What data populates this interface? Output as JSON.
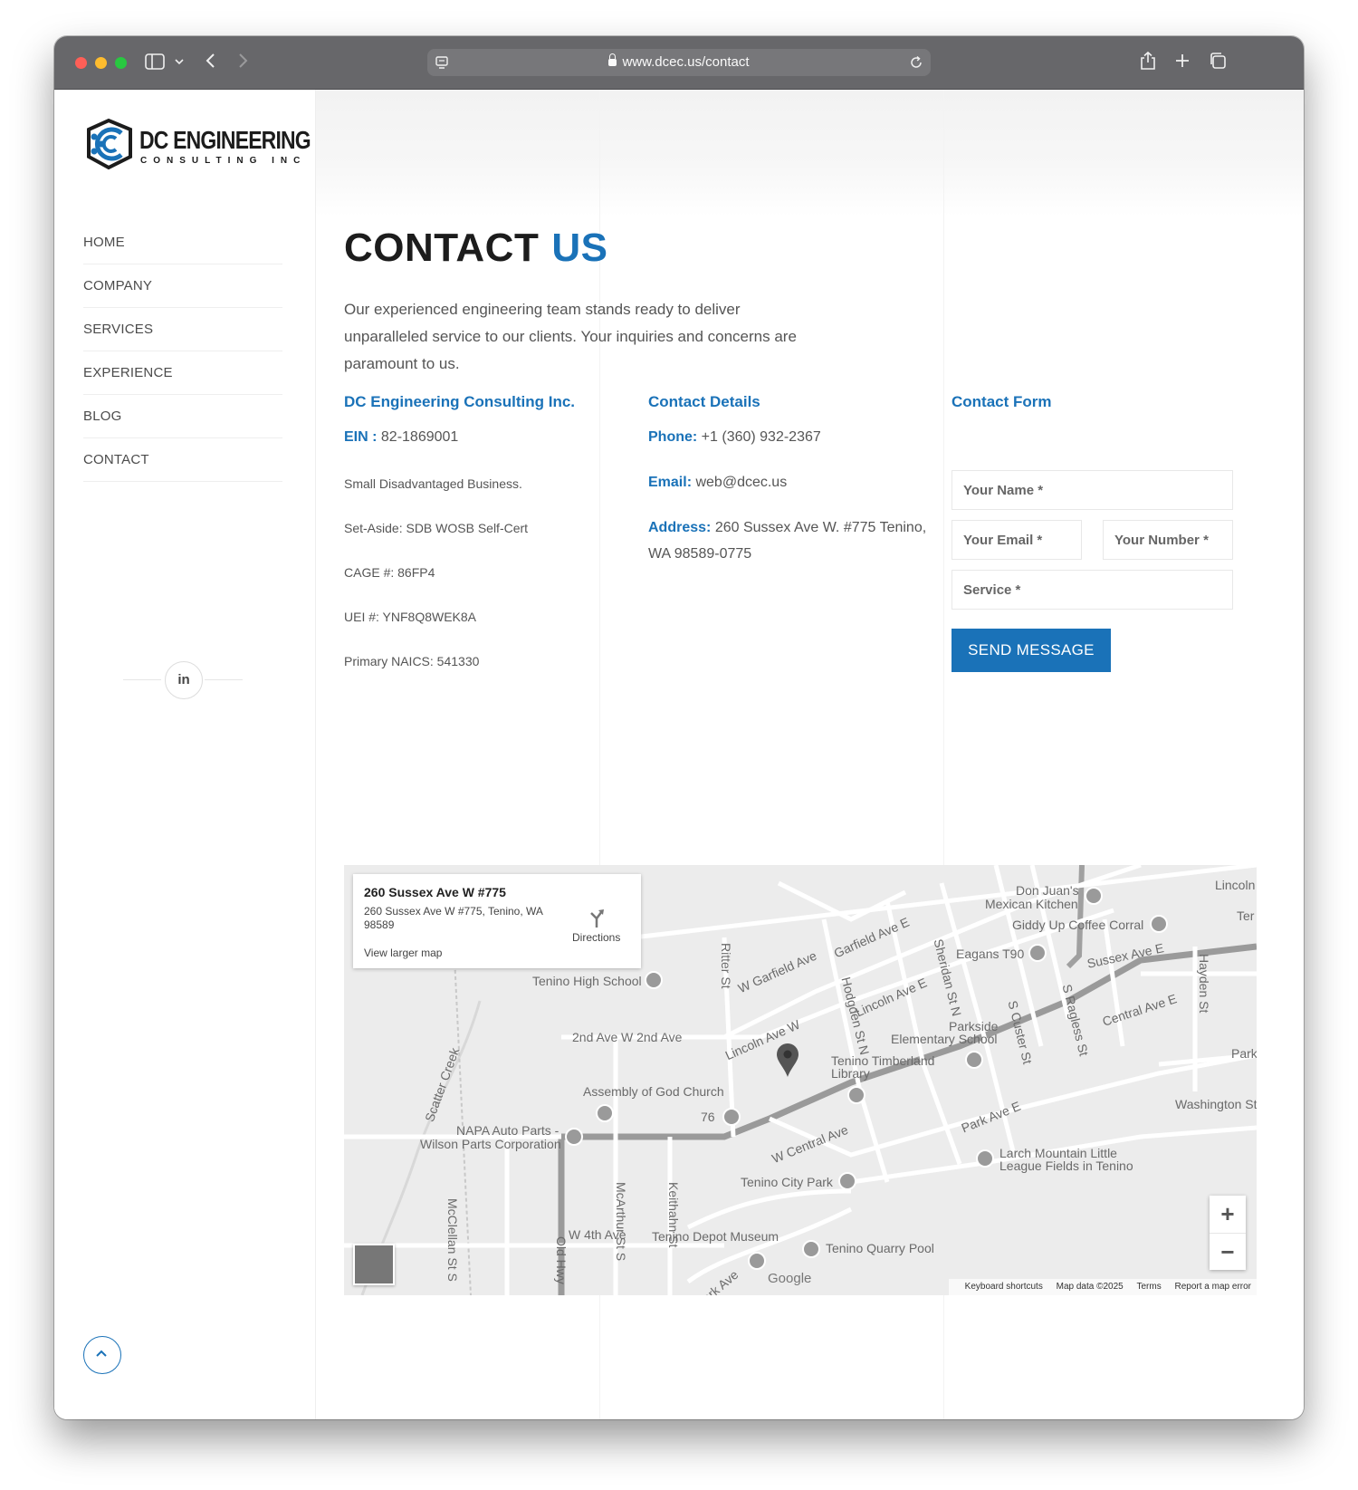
{
  "browser": {
    "url": "www.dcec.us/contact"
  },
  "logo": {
    "main": "DC ENGINEERING",
    "sub": "CONSULTING INC"
  },
  "nav": {
    "items": [
      {
        "label": "HOME"
      },
      {
        "label": "COMPANY"
      },
      {
        "label": "SERVICES"
      },
      {
        "label": "EXPERIENCE"
      },
      {
        "label": "BLOG"
      },
      {
        "label": "CONTACT"
      }
    ]
  },
  "social": {
    "linkedin": "in"
  },
  "page": {
    "title_1": "CONTACT",
    "title_2": "US",
    "intro": "Our experienced engineering team stands ready to deliver unparalleled service to our clients. Your inquiries and concerns are paramount to us."
  },
  "company": {
    "heading": "DC Engineering Consulting Inc.",
    "ein_label": "EIN :",
    "ein_value": "82-1869001",
    "line1": "Small Disadvantaged Business.",
    "line2": "Set-Aside: SDB WOSB Self-Cert",
    "line3": "CAGE #: 86FP4",
    "line4": "UEI #: YNF8Q8WEK8A",
    "line5": "Primary NAICS: 541330"
  },
  "details": {
    "heading": "Contact Details",
    "phone_label": "Phone:",
    "phone_value": "+1 (360) 932-2367",
    "email_label": "Email:",
    "email_value": "web@dcec.us",
    "address_label": "Address:",
    "address_line1": "260 Sussex Ave W. #775 Tenino,",
    "address_line2": "WA 98589-0775"
  },
  "form": {
    "heading": "Contact Form",
    "name_placeholder": "Your Name *",
    "email_placeholder": "Your Email *",
    "number_placeholder": "Your Number *",
    "service_placeholder": "Service *",
    "submit_label": "SEND MESSAGE"
  },
  "map": {
    "card_title": "260 Sussex Ave W #775",
    "card_address": "260 Sussex Ave W #775, Tenino, WA 98589",
    "card_link": "View larger map",
    "directions": "Directions",
    "zoom_in": "+",
    "zoom_out": "−",
    "google": "Google",
    "attribution": [
      "Keyboard shortcuts",
      "Map data ©2025",
      "Terms",
      "Report a map error"
    ],
    "labels": [
      "Tenino High School",
      "2nd Ave",
      "W 2nd Ave",
      "Assembly of God Church",
      "NAPA Auto Parts -",
      "Wilson Parts Corporation",
      "McClellan St S",
      "McArthur St S",
      "Keithahn St",
      "W 4th Ave",
      "Tenino Depot Museum",
      "Tenino Quarry Pool",
      "Tenino City Park",
      "W Central Ave",
      "Lincoln Ave W",
      "W Garfield Ave",
      "Garfield Ave E",
      "Ritter St",
      "Hodgden St N",
      "Lincoln Ave E",
      "Sheridan St N",
      "Tenino Timberland",
      "Library",
      "Parkside",
      "Elementary School",
      "Don Juan's",
      "Mexican Kitchen",
      "Giddy Up Coffee Corral",
      "Eagans T90",
      "Sussex Ave E",
      "S Custer St",
      "S Ragless St",
      "Central Ave E",
      "Hayden St",
      "Lincoln",
      "Ter",
      "Park",
      "Washington St",
      "Park Ave E",
      "Larch Mountain Little",
      "League Fields in Tenino",
      "Scatter Creek",
      "76",
      "Park Ave",
      "Old Hwy"
    ]
  },
  "colors": {
    "accent": "#1a72b8",
    "text": "#555555",
    "heading": "#1c1c1c"
  }
}
